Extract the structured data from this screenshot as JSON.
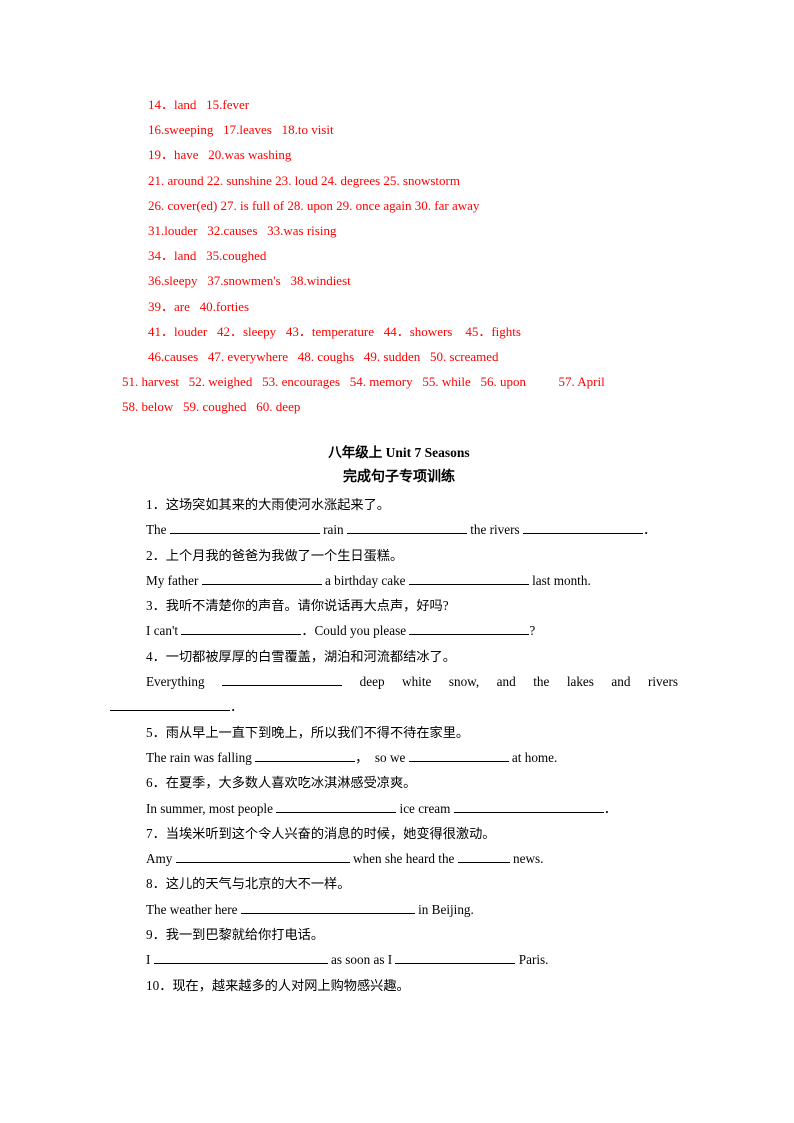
{
  "document": {
    "title": "八年级上 Unit 7 Seasons",
    "subtitle": "完成句子专项训练",
    "text_color": "#000000",
    "answer_color": "#ff0000"
  },
  "answer_key": {
    "lines": [
      {
        "text": "14．land   15.fever",
        "indent": true
      },
      {
        "text": "16.sweeping   17.leaves   18.to visit",
        "indent": true
      },
      {
        "text": "19．have   20.was washing",
        "indent": true
      },
      {
        "text": "21. around 22. sunshine 23. loud 24. degrees 25. snowstorm",
        "indent": true
      },
      {
        "text": "26. cover(ed) 27. is full of 28. upon 29. once again 30. far away",
        "indent": true
      },
      {
        "text": "31.louder   32.causes   33.was rising",
        "indent": true
      },
      {
        "text": "34．land   35.coughed",
        "indent": true
      },
      {
        "text": "36.sleepy   37.snowmen's   38.windiest",
        "indent": true
      },
      {
        "text": "39．are   40.forties",
        "indent": true
      },
      {
        "text": "41．louder   42．sleepy   43．temperature   44．showers    45．fights",
        "indent": true
      },
      {
        "text": "46.causes   47. everywhere   48. coughs   49. sudden   50. screamed",
        "indent": true
      },
      {
        "text": "51. harvest   52. weighed   53. encourages   54. memory   55. while   56. upon          57. April",
        "indent": false
      },
      {
        "text": "58. below   59. coughed   60. deep",
        "indent": false
      }
    ]
  },
  "exercises": [
    {
      "number": "1．",
      "chinese": "这场突如其来的大雨使河水涨起来了。",
      "en_parts": [
        "The ",
        " rain ",
        " the rivers ",
        "．"
      ]
    },
    {
      "number": "2．",
      "chinese": "上个月我的爸爸为我做了一个生日蛋糕。",
      "en_parts": [
        "My father ",
        " a birthday cake ",
        " last month."
      ]
    },
    {
      "number": "3．",
      "chinese": "我听不清楚你的声音。请你说话再大点声，好吗?",
      "en_parts": [
        "I can't ",
        "．Could you please ",
        "?"
      ]
    },
    {
      "number": "4．",
      "chinese": "一切都被厚厚的白雪覆盖，湖泊和河流都结冰了。",
      "en_justified_head": "Everything",
      "en_justified_mid": "deep white snow, and the lakes and rivers",
      "en_justified_tail": "．"
    },
    {
      "number": "5．",
      "chinese": "雨从早上一直下到晚上，所以我们不得不待在家里。",
      "en_parts": [
        "The rain was falling ",
        "，  so we ",
        " at home."
      ]
    },
    {
      "number": "6．",
      "chinese": "在夏季，大多数人喜欢吃冰淇淋感受凉爽。",
      "en_parts": [
        "In summer, most people ",
        " ice cream ",
        "．"
      ]
    },
    {
      "number": "7．",
      "chinese": "当埃米听到这个令人兴奋的消息的时候，她变得很激动。",
      "en_parts": [
        "Amy ",
        " when she heard the ",
        " news."
      ]
    },
    {
      "number": "8．",
      "chinese": "这儿的天气与北京的大不一样。",
      "en_parts": [
        "The weather here ",
        " in Beijing."
      ]
    },
    {
      "number": "9．",
      "chinese": "我一到巴黎就给你打电话。",
      "en_parts": [
        "I ",
        " as soon as I ",
        " Paris."
      ]
    },
    {
      "number": "10．",
      "chinese": "现在，越来越多的人对网上购物感兴趣。",
      "en_parts": []
    }
  ]
}
